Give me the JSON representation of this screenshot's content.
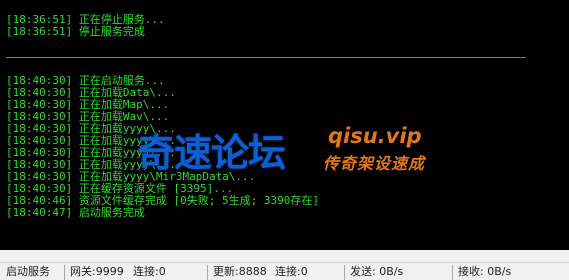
{
  "console": {
    "lines": [
      "[18:36:51] 正在停止服务...",
      "[18:36:51] 停止服务完成",
      "[18:40:30] 正在启动服务...",
      "[18:40:30] 正在加载Data\\...",
      "[18:40:30] 正在加载Map\\...",
      "[18:40:30] 正在加载Wav\\...",
      "[18:40:30] 正在加载yyyy\\...",
      "[18:40:30] 正在加载yyyy\\...",
      "[18:40:30] 正在加载yyyy\\...",
      "[18:40:30] 正在加载yyyy\\...",
      "[18:40:30] 正在加载yyyy\\Mir3MapData\\...",
      "[18:40:30] 正在缓存资源文件 [3395]...",
      "[18:40:46] 资源文件缓存完成 [0失败; 5生成; 3390存在]",
      "[18:40:47] 启动服务完成"
    ],
    "text_color": "#2fdc2f"
  },
  "watermark": {
    "chinese": "奇速论坛",
    "url": "qisu.vip",
    "subtitle": "传奇架设速成"
  },
  "statusbar": {
    "start_service": "启动服务",
    "gateway": "网关:9999",
    "gateway_conn": "连接:0",
    "update": "更新:8888",
    "update_conn": "连接:0",
    "send": "发送: 0B/s",
    "receive": "接收: 0B/s"
  }
}
